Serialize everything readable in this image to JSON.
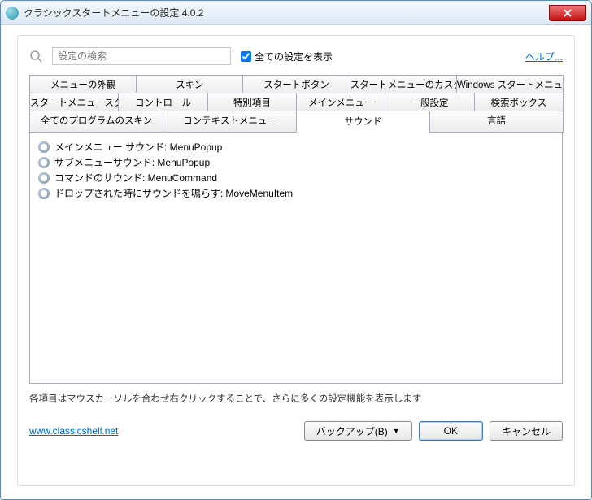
{
  "window": {
    "title": "クラシックスタートメニューの設定 4.0.2"
  },
  "search": {
    "placeholder": "設定の検索"
  },
  "show_all": {
    "label": "全ての設定を表示",
    "checked": true
  },
  "help_link": "ヘルプ...",
  "tabs": {
    "row1": [
      "メニューの外観",
      "スキン",
      "スタートボタン",
      "スタートメニューのカスタマイズ",
      "Windows スタートメニュー"
    ],
    "row2": [
      "スタートメニュースタイル",
      "コントロール",
      "特別項目",
      "メインメニュー",
      "一般設定",
      "検索ボックス"
    ],
    "row3": [
      "全てのプログラムのスキン",
      "コンテキストメニュー",
      "サウンド",
      "言語"
    ],
    "active": "サウンド"
  },
  "items": [
    "メインメニュー サウンド: MenuPopup",
    "サブメニューサウンド: MenuPopup",
    "コマンドのサウンド: MenuCommand",
    "ドロップされた時にサウンドを鳴らす: MoveMenuItem"
  ],
  "hint": "各項目はマウスカーソルを合わせ右クリックすることで、さらに多くの設定機能を表示します",
  "footer": {
    "url": "www.classicshell.net",
    "backup": "バックアップ(B)",
    "ok": "OK",
    "cancel": "キャンセル"
  }
}
